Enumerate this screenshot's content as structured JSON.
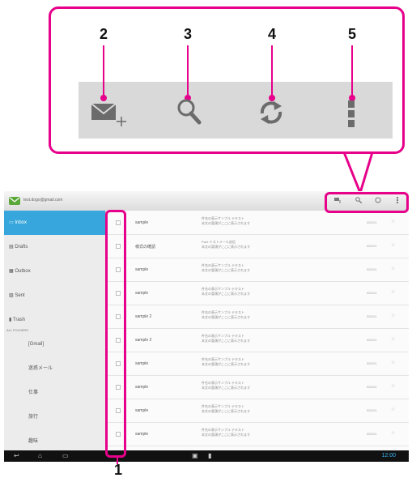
{
  "callouts": {
    "top_numbers": [
      "2",
      "3",
      "4",
      "5"
    ],
    "bottom_number": "1"
  },
  "action_icons": [
    "compose-mail-icon",
    "search-icon",
    "refresh-icon",
    "overflow-menu-icon"
  ],
  "app": {
    "account_name": "test.dogo@gmail.com",
    "sidebar": {
      "items": [
        {
          "label": "Inbox",
          "icon": "inbox-icon",
          "selected": true
        },
        {
          "label": "Drafts",
          "icon": "drafts-icon",
          "selected": false
        },
        {
          "label": "Outbox",
          "icon": "outbox-icon",
          "selected": false
        },
        {
          "label": "Sent",
          "icon": "sent-icon",
          "selected": false
        },
        {
          "label": "Trash",
          "icon": "trash-icon",
          "selected": false
        }
      ],
      "folders_header": "ALL FOLDERS",
      "folders": [
        "[Gmail]",
        "迷惑メール",
        "仕事",
        "旅行",
        "趣味"
      ]
    },
    "rows": [
      {
        "sender": "sample",
        "subject1": "件名の表示サンプル テキスト",
        "subject2": "本文の冒頭がここに表示されます",
        "date": "2012/1"
      },
      {
        "sender": "様式の確認",
        "subject1": "Fwd: テストメール送信",
        "subject2": "本文の冒頭がここに表示されます",
        "date": "2012/1"
      },
      {
        "sender": "sample",
        "subject1": "件名の表示サンプル テキスト",
        "subject2": "本文の冒頭がここに表示されます",
        "date": "2012/1"
      },
      {
        "sender": "sample",
        "subject1": "件名の表示サンプル テキスト",
        "subject2": "本文の冒頭がここに表示されます",
        "date": "2012/1"
      },
      {
        "sender": "sample 2",
        "subject1": "件名の表示サンプル テキスト",
        "subject2": "本文の冒頭がここに表示されます",
        "date": "2012/1"
      },
      {
        "sender": "sample 2",
        "subject1": "件名の表示サンプル テキスト",
        "subject2": "本文の冒頭がここに表示されます",
        "date": "2012/1"
      },
      {
        "sender": "sample",
        "subject1": "件名の表示サンプル テキスト",
        "subject2": "本文の冒頭がここに表示されます",
        "date": "2012/1"
      },
      {
        "sender": "sample",
        "subject1": "件名の表示サンプル テキスト",
        "subject2": "本文の冒頭がここに表示されます",
        "date": "2012/1"
      },
      {
        "sender": "sample",
        "subject1": "件名の表示サンプル テキスト",
        "subject2": "本文の冒頭がここに表示されます",
        "date": "2012/1"
      },
      {
        "sender": "sample",
        "subject1": "件名の表示サンプル テキスト",
        "subject2": "本文の冒頭がここに表示されます",
        "date": "2012/1"
      }
    ],
    "status_time": "12:00"
  },
  "colors": {
    "highlight": "#e6008a",
    "selected": "#36a6dc",
    "time": "#38b4f0"
  }
}
